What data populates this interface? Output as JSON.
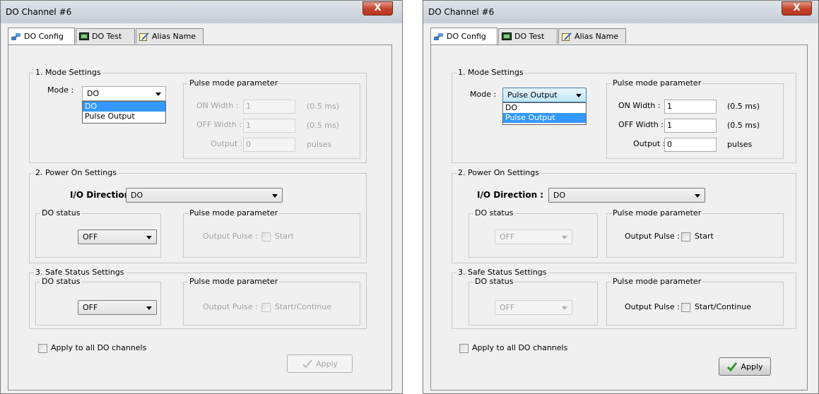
{
  "left": {
    "title": "DO Channel #6",
    "close_glyph": "X",
    "tabs": [
      {
        "label": "DO Config",
        "icon": "network-icon"
      },
      {
        "label": "DO Test",
        "icon": "monitor-icon"
      },
      {
        "label": "Alias Name",
        "icon": "notepad-pencil-icon"
      }
    ],
    "mode_settings": {
      "group_label": "1. Mode Settings",
      "mode_label": "Mode :",
      "mode_value": "DO",
      "mode_options": [
        "DO",
        "Pulse Output"
      ],
      "highlighted_option": "DO",
      "pulse_group_label": "Pulse mode parameter",
      "on_width_label": "ON Width :",
      "on_width_value": "1",
      "on_width_unit": "(0.5 ms)",
      "off_width_label": "OFF Width :",
      "off_width_value": "1",
      "off_width_unit": "(0.5 ms)",
      "output_label": "Output :",
      "output_value": "0",
      "output_unit": "pulses"
    },
    "power_on": {
      "group_label": "2. Power On Settings",
      "io_direction_label": "I/O Direction :",
      "io_direction_value": "DO",
      "do_status_label": "DO status",
      "do_status_value": "OFF",
      "pulse_group_label": "Pulse mode parameter",
      "output_pulse_label": "Output Pulse :",
      "start_label": "Start"
    },
    "safe_status": {
      "group_label": "3. Safe Status Settings",
      "do_status_label": "DO status",
      "do_status_value": "OFF",
      "pulse_group_label": "Pulse mode parameter",
      "output_pulse_label": "Output Pulse :",
      "start_label": "Start/Continue"
    },
    "apply_all_label": "Apply to all DO channels",
    "apply_label": "Apply",
    "apply_enabled": false
  },
  "right": {
    "title": "DO Channel #6",
    "close_glyph": "X",
    "tabs": [
      {
        "label": "DO Config",
        "icon": "network-icon"
      },
      {
        "label": "DO Test",
        "icon": "monitor-icon"
      },
      {
        "label": "Alias Name",
        "icon": "notepad-pencil-icon"
      }
    ],
    "mode_settings": {
      "group_label": "1. Mode Settings",
      "mode_label": "Mode :",
      "mode_value": "Pulse Output",
      "mode_options": [
        "DO",
        "Pulse Output"
      ],
      "highlighted_option": "Pulse Output",
      "pulse_group_label": "Pulse mode parameter",
      "on_width_label": "ON Width :",
      "on_width_value": "1",
      "on_width_unit": "(0.5 ms)",
      "off_width_label": "OFF Width :",
      "off_width_value": "1",
      "off_width_unit": "(0.5 ms)",
      "output_label": "Output :",
      "output_value": "0",
      "output_unit": "pulses"
    },
    "power_on": {
      "group_label": "2. Power On Settings",
      "io_direction_label": "I/O Direction :",
      "io_direction_value": "DO",
      "do_status_label": "DO status",
      "do_status_value": "OFF",
      "pulse_group_label": "Pulse mode parameter",
      "output_pulse_label": "Output Pulse :",
      "start_label": "Start"
    },
    "safe_status": {
      "group_label": "3. Safe Status Settings",
      "do_status_label": "DO status",
      "do_status_value": "OFF",
      "pulse_group_label": "Pulse mode parameter",
      "output_pulse_label": "Output Pulse :",
      "start_label": "Start/Continue"
    },
    "apply_all_label": "Apply to all DO channels",
    "apply_label": "Apply",
    "apply_enabled": true
  }
}
